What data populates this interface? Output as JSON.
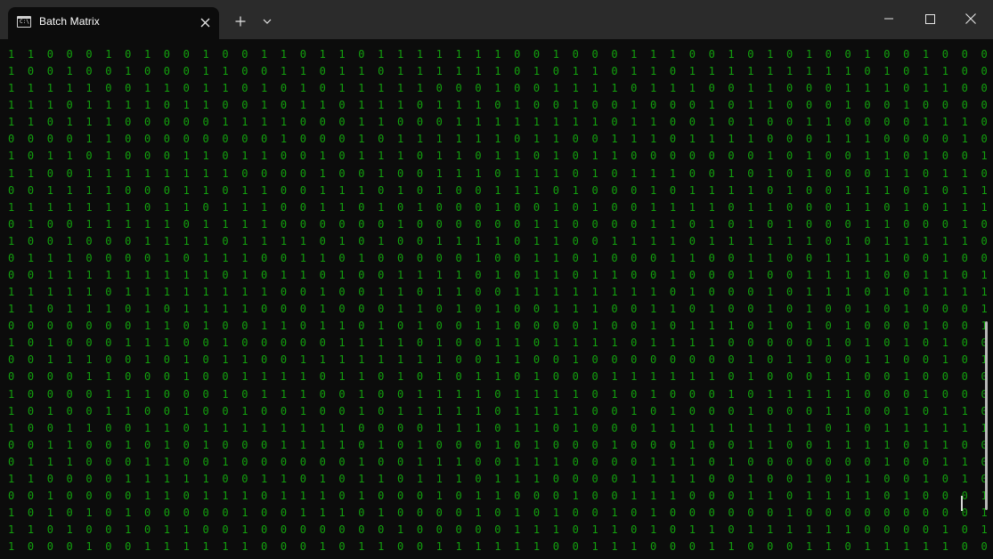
{
  "window": {
    "tab_title": "Batch Matrix",
    "tab_icon_glyph": "C:\\",
    "new_tab_glyph": "+"
  },
  "colors": {
    "titlebar": "#2b2b2b",
    "background": "#0c0c0c",
    "text_green": "#13a10e"
  },
  "icons": {
    "tab_icon": "terminal-icon",
    "tab_close": "close-icon",
    "new_tab": "plus-icon",
    "dropdown": "chevron-down-icon",
    "minimize": "minimize-icon",
    "maximize": "maximize-icon",
    "close": "close-icon"
  },
  "terminal": {
    "lines": [
      "1 1 0 0 0 1 0 1 0 0 1 0 0 1 1 0 1 1 0 1 1 1 1 1 1 1 0 0 1 0 0 0 1 1 1 0 0 1 0 1 0 1 0 0 1 0 0 1 0 0 0 0 0 1 1 0 0 1 1 0",
      "1 0 0 1 0 0 1 0 0 0 1 1 0 0 1 1 0 1 1 0 1 1 1 1 1 1 0 1 0 1 1 0 1 1 0 1 1 1 1 1 1 1 1 1 0 1 0 1 1 0 0 0 1 1 0 0 0 0 1 1",
      "1 1 1 1 1 0 0 1 1 0 1 1 0 1 0 1 0 1 1 1 1 1 0 0 0 1 0 0 1 1 1 1 0 1 1 1 0 0 1 1 0 0 0 1 1 1 0 1 1 0 0 0 1 0 0 0 1 0 0 0",
      "1 1 1 0 1 1 1 1 0 1 1 0 0 1 0 1 1 0 1 1 1 0 1 1 1 0 1 0 0 1 0 0 1 0 0 0 1 0 1 1 0 0 0 1 0 0 1 0 0 0 0 0 0 0 1 0 1 1 0 1",
      "1 1 0 1 1 1 0 0 0 0 0 1 1 1 1 0 0 0 1 1 0 0 0 1 1 1 1 1 1 1 1 0 1 1 0 0 1 0 1 0 0 1 1 0 0 0 0 1 1 1 0 0 0 1 1 1 0 1 1 1",
      "0 0 0 0 1 1 0 0 0 0 0 0 0 0 1 0 0 0 1 0 1 1 1 1 1 1 0 1 1 0 0 1 1 1 0 1 1 1 1 0 0 0 1 1 1 0 0 0 0 1 0 1 1 0 1 1 1 0 1 0",
      "1 0 1 1 0 1 0 0 0 1 1 0 1 1 0 0 1 0 1 1 1 0 1 1 0 1 1 0 1 0 1 1 0 0 0 0 0 0 0 1 0 1 0 0 1 1 0 1 0 0 1 1 1 1 0 0 0 0 0 1",
      "1 1 0 0 1 1 1 1 1 1 1 1 0 0 0 0 1 0 0 1 0 0 1 1 1 0 1 1 1 0 1 0 1 1 1 0 0 1 0 1 0 1 0 0 0 1 1 0 1 1 0 0 1 1 1 1 1 1 1 0",
      "0 0 1 1 1 1 0 0 0 1 1 0 1 1 0 0 1 1 1 0 1 0 1 0 0 1 1 1 0 1 0 0 0 1 0 1 1 1 1 0 1 0 0 1 1 1 0 1 0 1 1 1 0 0 1 1 1 1 1 1",
      "1 1 1 1 1 1 1 0 1 1 0 1 1 1 0 0 1 1 0 1 0 1 0 0 0 1 0 0 1 0 1 0 0 1 1 1 1 0 1 1 0 0 0 1 1 0 1 0 1 1 1 1 0 0 0 0 0 0 0 1",
      "0 1 0 0 1 1 1 1 1 0 1 1 1 1 0 0 0 0 0 0 1 0 0 0 0 0 0 1 1 0 0 0 0 1 1 0 1 0 1 0 1 0 0 0 1 1 0 0 0 1 0 0 1 0 1 1 0 1 1 1",
      "1 0 0 1 0 0 0 1 1 1 1 0 1 1 1 1 0 1 0 1 0 0 1 1 1 1 0 1 1 0 0 1 1 1 1 0 1 1 1 1 1 1 0 1 0 1 1 1 1 1 0 1 1 0 0 1 1 0 1 1",
      "0 1 1 1 0 0 0 0 1 0 1 1 1 0 0 1 1 0 1 0 0 0 0 0 1 0 0 1 1 0 1 0 0 0 1 1 0 0 1 1 0 0 1 1 1 1 0 0 1 0 0 1 0 1 1 0 0 0 0 1",
      "0 0 1 1 1 1 1 1 1 1 1 0 1 0 1 1 0 1 0 0 1 1 1 1 0 1 0 1 1 0 1 1 0 0 1 0 0 0 1 0 0 1 1 1 1 0 0 1 1 0 1 1 0 1 0 0 0 0 1 0",
      "1 1 1 1 1 0 1 1 1 1 1 1 1 1 0 0 1 0 0 1 1 0 1 1 0 0 1 1 1 1 1 1 1 1 0 1 0 0 0 1 0 1 1 1 0 1 0 1 1 1 1 0 0 1 1 0 1 0 0 1",
      "1 1 0 1 1 1 0 1 0 1 1 1 1 0 0 0 1 0 0 0 1 1 0 1 0 1 0 0 1 1 1 0 0 1 1 0 1 0 0 1 0 1 0 0 1 0 1 0 0 0 1 1 0 1 1 0 1 1 0 0",
      "0 0 0 0 0 0 0 1 1 0 1 0 0 1 1 0 1 1 0 1 0 1 0 0 1 1 0 0 0 0 1 0 0 1 0 1 1 1 0 1 0 1 0 1 0 0 0 1 0 0 1 1 1 0 0 0 0 0 0 0",
      "1 0 1 0 0 0 1 1 1 0 0 1 0 0 0 0 0 1 1 1 1 0 1 0 0 1 1 0 1 1 1 1 0 1 1 1 1 0 0 0 0 0 1 0 1 0 1 0 1 0 0 0 0 0 1 1 1 1 1 1",
      "0 0 1 1 1 0 0 1 0 1 0 1 1 0 0 1 1 1 1 1 1 1 1 0 0 1 1 0 0 1 0 0 0 0 0 0 0 0 1 0 1 1 0 0 1 1 0 0 1 0 1 1 0 0 0 0 1 0 1 0",
      "0 0 0 0 1 1 0 0 0 1 0 0 1 1 1 1 0 1 1 0 1 0 1 0 1 1 0 1 0 0 0 1 1 1 1 1 1 0 1 0 0 0 1 1 0 0 1 0 0 0 0 1 1 1 1 1 0 1 1 1",
      "1 0 0 0 0 1 1 1 0 0 0 1 0 1 1 1 0 0 1 0 0 1 1 1 1 0 1 1 1 1 0 1 0 1 0 0 0 1 0 1 1 1 1 1 0 0 0 1 0 0 0 1 1 0 1 1 0 0 1 1",
      "1 0 1 0 0 1 1 0 0 1 0 0 1 0 0 1 0 0 1 0 1 1 1 1 1 0 1 1 1 1 0 0 1 0 1 0 0 0 1 0 0 0 1 1 0 0 1 0 1 1 0 1 1 1 1 1 1 0 0 0",
      "1 0 0 1 1 0 0 1 1 0 1 1 1 1 1 1 1 1 0 0 0 0 1 1 1 0 1 1 0 1 0 0 0 1 1 1 1 1 1 1 1 1 0 1 0 1 1 1 1 1 1 0 1 0 0 1 1 1 1 0",
      "0 0 1 1 0 0 1 0 1 0 1 0 0 0 1 1 1 1 0 1 0 1 0 0 0 1 0 1 0 0 0 1 0 0 0 1 0 0 1 1 0 0 1 1 1 1 0 1 1 0 0 1 0 1 1 1 1 0 1 1",
      "0 1 1 1 0 0 0 1 1 0 0 1 0 0 0 0 0 0 1 0 0 1 1 1 0 0 1 1 1 0 0 0 0 1 1 1 0 1 0 0 0 0 0 0 0 1 0 0 1 1 0 0 0 1 1 1 1 1 0 1",
      "1 1 0 0 0 0 1 1 1 1 1 0 0 1 1 0 1 0 1 1 0 1 1 1 0 1 1 1 0 0 0 0 1 1 1 1 0 0 1 0 0 1 0 1 1 0 0 1 0 1 0 1 0 0 0 0 0 0 0 0",
      "0 0 1 0 0 0 0 1 1 0 1 1 1 0 1 1 1 0 1 0 0 0 1 0 1 1 0 0 0 1 0 0 1 1 1 0 0 0 1 1 0 1 1 1 1 0 1 0 0 0 1 0 1 1 1 1 1 0 0 1",
      "1 0 1 0 1 0 1 0 0 0 0 0 1 0 0 1 1 1 0 1 0 0 0 0 1 0 1 0 1 0 0 1 0 1 0 0 0 0 0 0 1 0 0 0 0 0 0 0 0 0 1 0 1 0 0 0 1 0 0 0",
      "1 1 0 1 0 0 1 0 1 1 0 0 1 0 0 0 0 0 0 0 1 0 0 0 0 0 1 1 1 0 1 1 0 1 0 1 1 0 1 1 1 1 1 1 0 0 0 0 1 0 1 1 0 1 0 0 0 0 0 1",
      "1 0 0 0 1 0 0 1 1 1 1 1 1 0 0 0 1 0 1 1 0 0 1 1 1 1 1 1 0 0 1 1 1 0 0 0 1 1 0 0 0 1 1 0 1 1 1 1 1 0 0 0 0 0 1 0 0 1 1 1"
    ]
  }
}
